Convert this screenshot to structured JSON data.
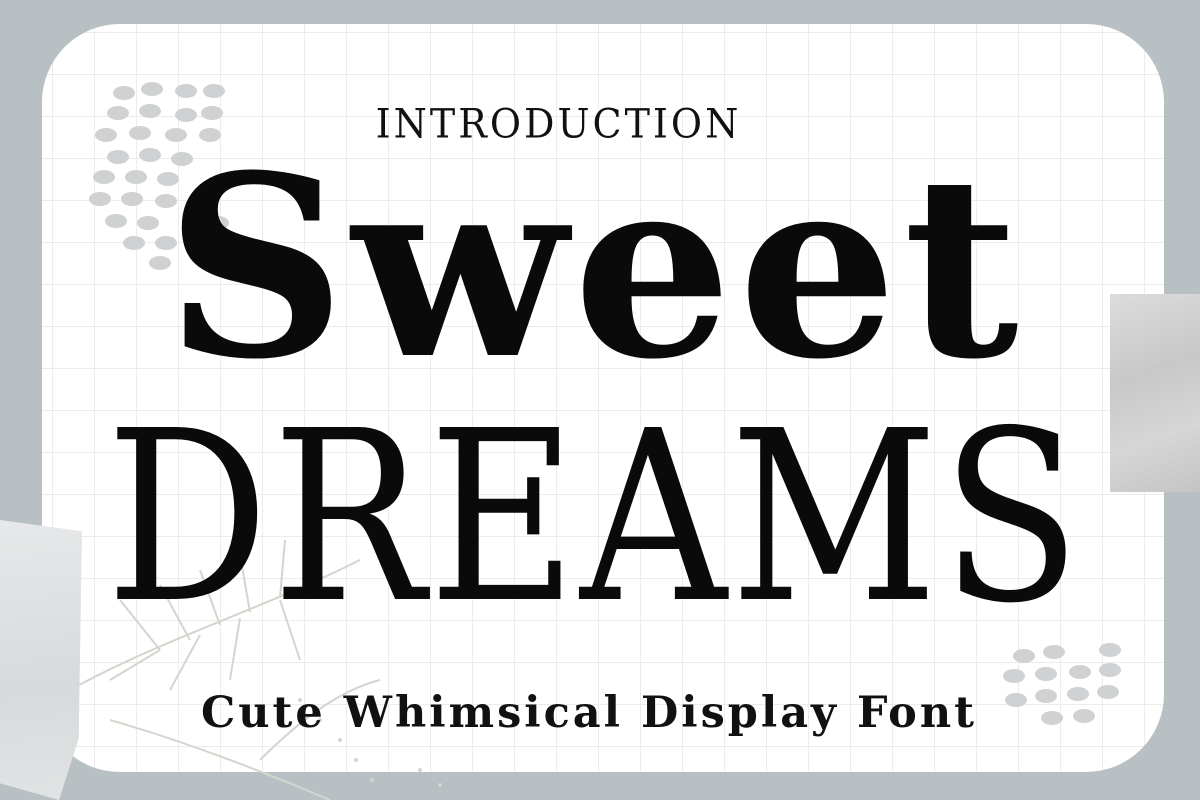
{
  "intro_label": "INTRODUCTION",
  "title": {
    "line1": "Sweet",
    "line2": "DREAMS"
  },
  "subtitle": "Cute Whimsical Display Font",
  "colors": {
    "background": "#b9c0c3",
    "card": "#ffffff",
    "grid": "#ececec",
    "text": "#0a0a0a",
    "dots": "#cfd1d2",
    "foliage": "#d2d6cd"
  },
  "decorations": [
    "dot-cluster-top-left",
    "dot-cluster-bottom-right",
    "leaf-branch",
    "paper-tape-left",
    "paper-tape-right"
  ]
}
